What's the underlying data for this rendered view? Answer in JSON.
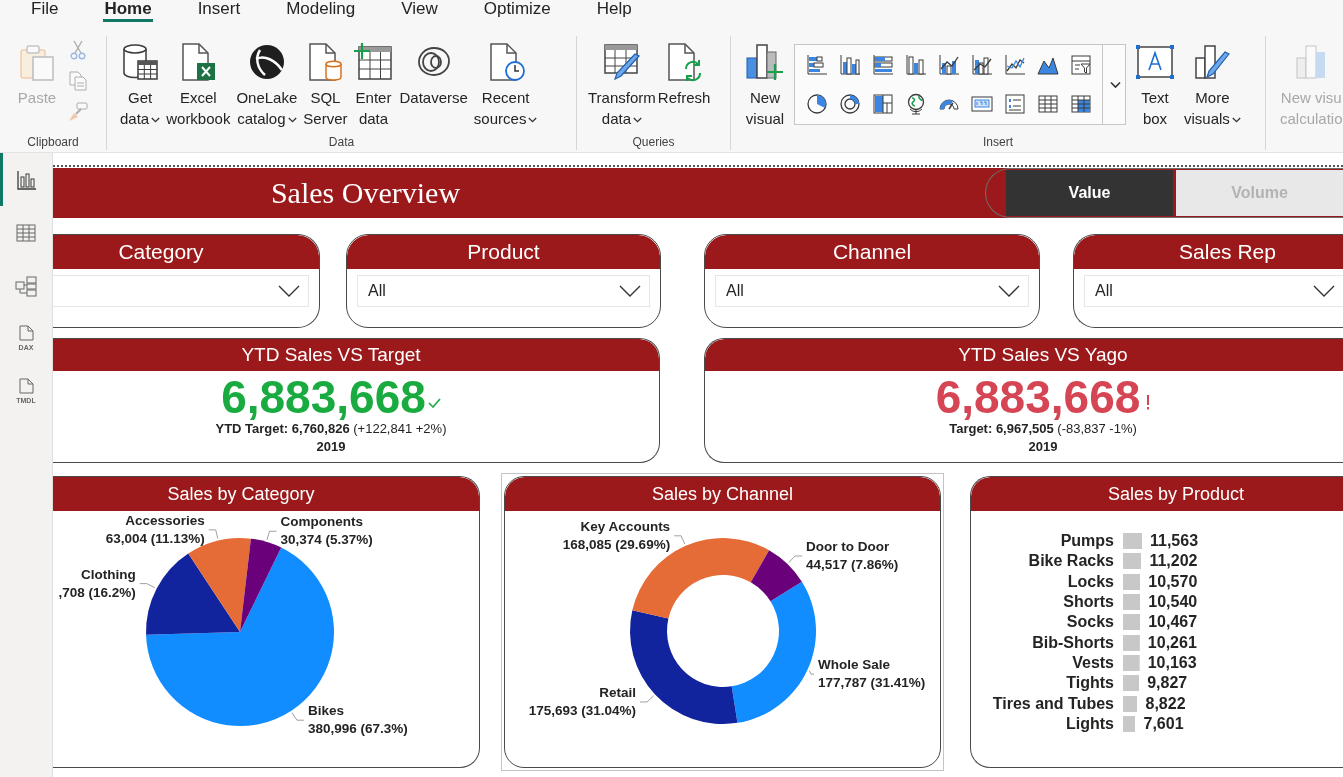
{
  "menu_tabs": [
    {
      "label": "File",
      "selected": false
    },
    {
      "label": "Home",
      "selected": true
    },
    {
      "label": "Insert",
      "selected": false
    },
    {
      "label": "Modeling",
      "selected": false
    },
    {
      "label": "View",
      "selected": false
    },
    {
      "label": "Optimize",
      "selected": false
    },
    {
      "label": "Help",
      "selected": false
    }
  ],
  "ribbon": {
    "groups": [
      {
        "label": "Clipboard",
        "items": [
          {
            "kind": "paste",
            "lines": [
              "Paste"
            ],
            "dropdown": false,
            "disabled": true
          },
          {
            "kind": "stack",
            "buttons": [
              {
                "kind": "cut",
                "disabled": true
              },
              {
                "kind": "copy",
                "disabled": true
              },
              {
                "kind": "format_painter",
                "disabled": true
              }
            ]
          }
        ]
      },
      {
        "label": "Data",
        "items": [
          {
            "kind": "get_data",
            "lines": [
              "Get",
              "data"
            ],
            "dropdown": true,
            "disabled": false
          },
          {
            "kind": "excel",
            "lines": [
              "Excel",
              "workbook"
            ],
            "dropdown": false,
            "disabled": false
          },
          {
            "kind": "onelake",
            "lines": [
              "OneLake",
              "catalog"
            ],
            "dropdown": true,
            "disabled": false
          },
          {
            "kind": "sql",
            "lines": [
              "SQL",
              "Server"
            ],
            "dropdown": false,
            "disabled": false
          },
          {
            "kind": "enter_data",
            "lines": [
              "Enter",
              "data"
            ],
            "dropdown": false,
            "disabled": false
          },
          {
            "kind": "dataverse",
            "lines": [
              "Dataverse"
            ],
            "dropdown": false,
            "disabled": false
          },
          {
            "kind": "recent",
            "lines": [
              "Recent",
              "sources"
            ],
            "dropdown": true,
            "disabled": false
          }
        ]
      },
      {
        "label": "Queries",
        "items": [
          {
            "kind": "transform",
            "lines": [
              "Transform",
              "data"
            ],
            "dropdown": true,
            "disabled": false
          },
          {
            "kind": "refresh",
            "lines": [
              "Refresh"
            ],
            "dropdown": false,
            "disabled": false
          }
        ]
      },
      {
        "label": "Insert",
        "items": [
          {
            "kind": "new_visual",
            "lines": [
              "New",
              "visual"
            ],
            "dropdown": false,
            "disabled": false
          },
          {
            "kind": "gallery",
            "items": [
              {
                "kind": "stacked_bar"
              },
              {
                "kind": "clustered_column"
              },
              {
                "kind": "bar_100"
              },
              {
                "kind": "column"
              },
              {
                "kind": "line_column"
              },
              {
                "kind": "line_clustered"
              },
              {
                "kind": "line"
              },
              {
                "kind": "area"
              },
              {
                "kind": "filter"
              },
              {
                "kind": "pie"
              },
              {
                "kind": "donut"
              },
              {
                "kind": "treemap"
              },
              {
                "kind": "map"
              },
              {
                "kind": "gauge"
              },
              {
                "kind": "card"
              },
              {
                "kind": "multi_card"
              },
              {
                "kind": "table"
              },
              {
                "kind": "matrix"
              }
            ]
          },
          {
            "kind": "text_box",
            "lines": [
              "Text",
              "box"
            ],
            "dropdown": false,
            "disabled": false
          },
          {
            "kind": "more_visuals",
            "lines": [
              "More",
              "visuals"
            ],
            "dropdown": true,
            "disabled": false
          }
        ]
      },
      {
        "items": [
          {
            "kind": "visual_calculation",
            "lines": [
              "New visu",
              "calculatio"
            ],
            "dropdown": false,
            "disabled": true
          }
        ]
      }
    ]
  },
  "sidebar": {
    "items": [
      {
        "kind": "report",
        "selected": true
      },
      {
        "kind": "table",
        "selected": false
      },
      {
        "kind": "model",
        "selected": false
      },
      {
        "kind": "dax",
        "caption": "DAX",
        "selected": false
      },
      {
        "kind": "tmdl",
        "caption": "TMDL",
        "selected": false
      }
    ]
  },
  "report": {
    "title": "Sales Overview",
    "toggle": [
      {
        "label": "Value",
        "selected": true
      },
      {
        "label": "Volume",
        "selected": false
      }
    ],
    "slicers": [
      {
        "title": "Category"
      },
      {
        "title": "Product",
        "value": "All"
      },
      {
        "title": "Channel",
        "value": "All"
      },
      {
        "title": "Sales Rep",
        "value": "All"
      }
    ],
    "kpis": [
      {
        "kind": "above",
        "title": "YTD Sales VS Target",
        "value": "6,883,668",
        "detail": "**YTD Target: 6,760,826** (+122,841 +2%)",
        "year": "2019"
      },
      {
        "kind": "below",
        "title": "YTD Sales VS Yago",
        "value": "6,883,668",
        "detail": "**Target: 6,967,505** (-83,837 -1%)",
        "year": "2019"
      }
    ],
    "charts": [
      {
        "title": "Sales by Category",
        "focused": false,
        "chart_data": {
          "type": "pie",
          "categories": [
            "Bikes",
            "Clothing",
            "Accessories",
            "Components"
          ],
          "values": [
            67.3,
            16.2,
            11.13,
            5.37
          ],
          "colors": [
            "#118dff",
            "#12239e",
            "#e66c37",
            "#6b007b"
          ],
          "value_labels": [
            "380,996 (67.3%)",
            ",708 (16.2%)",
            "63,004 (11.13%)",
            "30,374 (5.37%)"
          ]
        }
      },
      {
        "title": "Sales by Channel",
        "focused": true,
        "chart_data": {
          "type": "donut",
          "categories": [
            "Whole Sale",
            "Retail",
            "Key Accounts",
            "Door to Door"
          ],
          "values": [
            31.41,
            31.04,
            29.69,
            7.86
          ],
          "colors": [
            "#118dff",
            "#12239e",
            "#e66c37",
            "#6b007b"
          ],
          "value_labels": [
            "177,787 (31.41%)",
            "175,693 (31.04%)",
            "168,085 (29.69%)",
            "44,517 (7.86%)"
          ]
        }
      },
      {
        "title": "Sales by Product",
        "focused": false,
        "chart_data": {
          "type": "bar",
          "orientation": "horizontal",
          "categories": [
            "Pumps",
            "Bike Racks",
            "Locks",
            "Shorts",
            "Socks",
            "Bib-Shorts",
            "Vests",
            "Tights",
            "Tires and Tubes",
            "Lights"
          ],
          "values": [
            11563,
            11202,
            10570,
            10540,
            10467,
            10261,
            10163,
            9827,
            8822,
            7601
          ],
          "value_labels": [
            "11,563",
            "11,202",
            "10,570",
            "10,540",
            "10,467",
            "10,261",
            "10,163",
            "9,827",
            "8,822",
            "7,601"
          ]
        }
      }
    ]
  }
}
